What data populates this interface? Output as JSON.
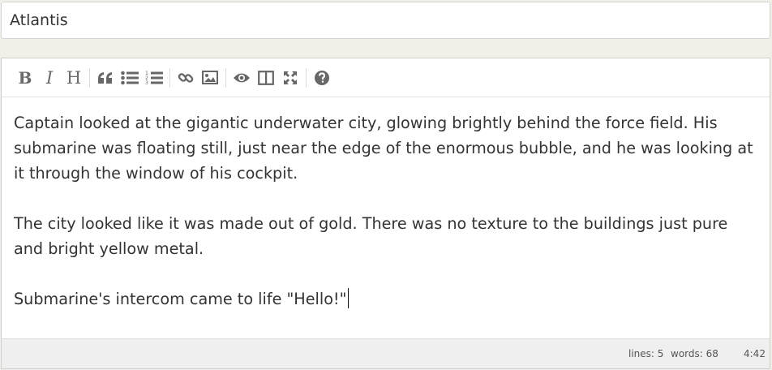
{
  "title": {
    "value": "Atlantis"
  },
  "toolbar": {
    "bold_label": "B",
    "italic_label": "I",
    "heading_label": "H"
  },
  "content": {
    "paragraphs": [
      "Captain looked at the gigantic underwater city, glowing brightly behind the force field. His submarine was floating still, just near the edge of the enormous bubble, and he was looking at it through the window of his cockpit.",
      "The city looked like it was made out of gold. There was no texture to the buildings just pure and bright yellow metal.",
      "Submarine's intercom came to life \"Hello!\""
    ]
  },
  "status": {
    "lines": "lines: 5",
    "words": "words: 68",
    "cursor": "4:42"
  }
}
